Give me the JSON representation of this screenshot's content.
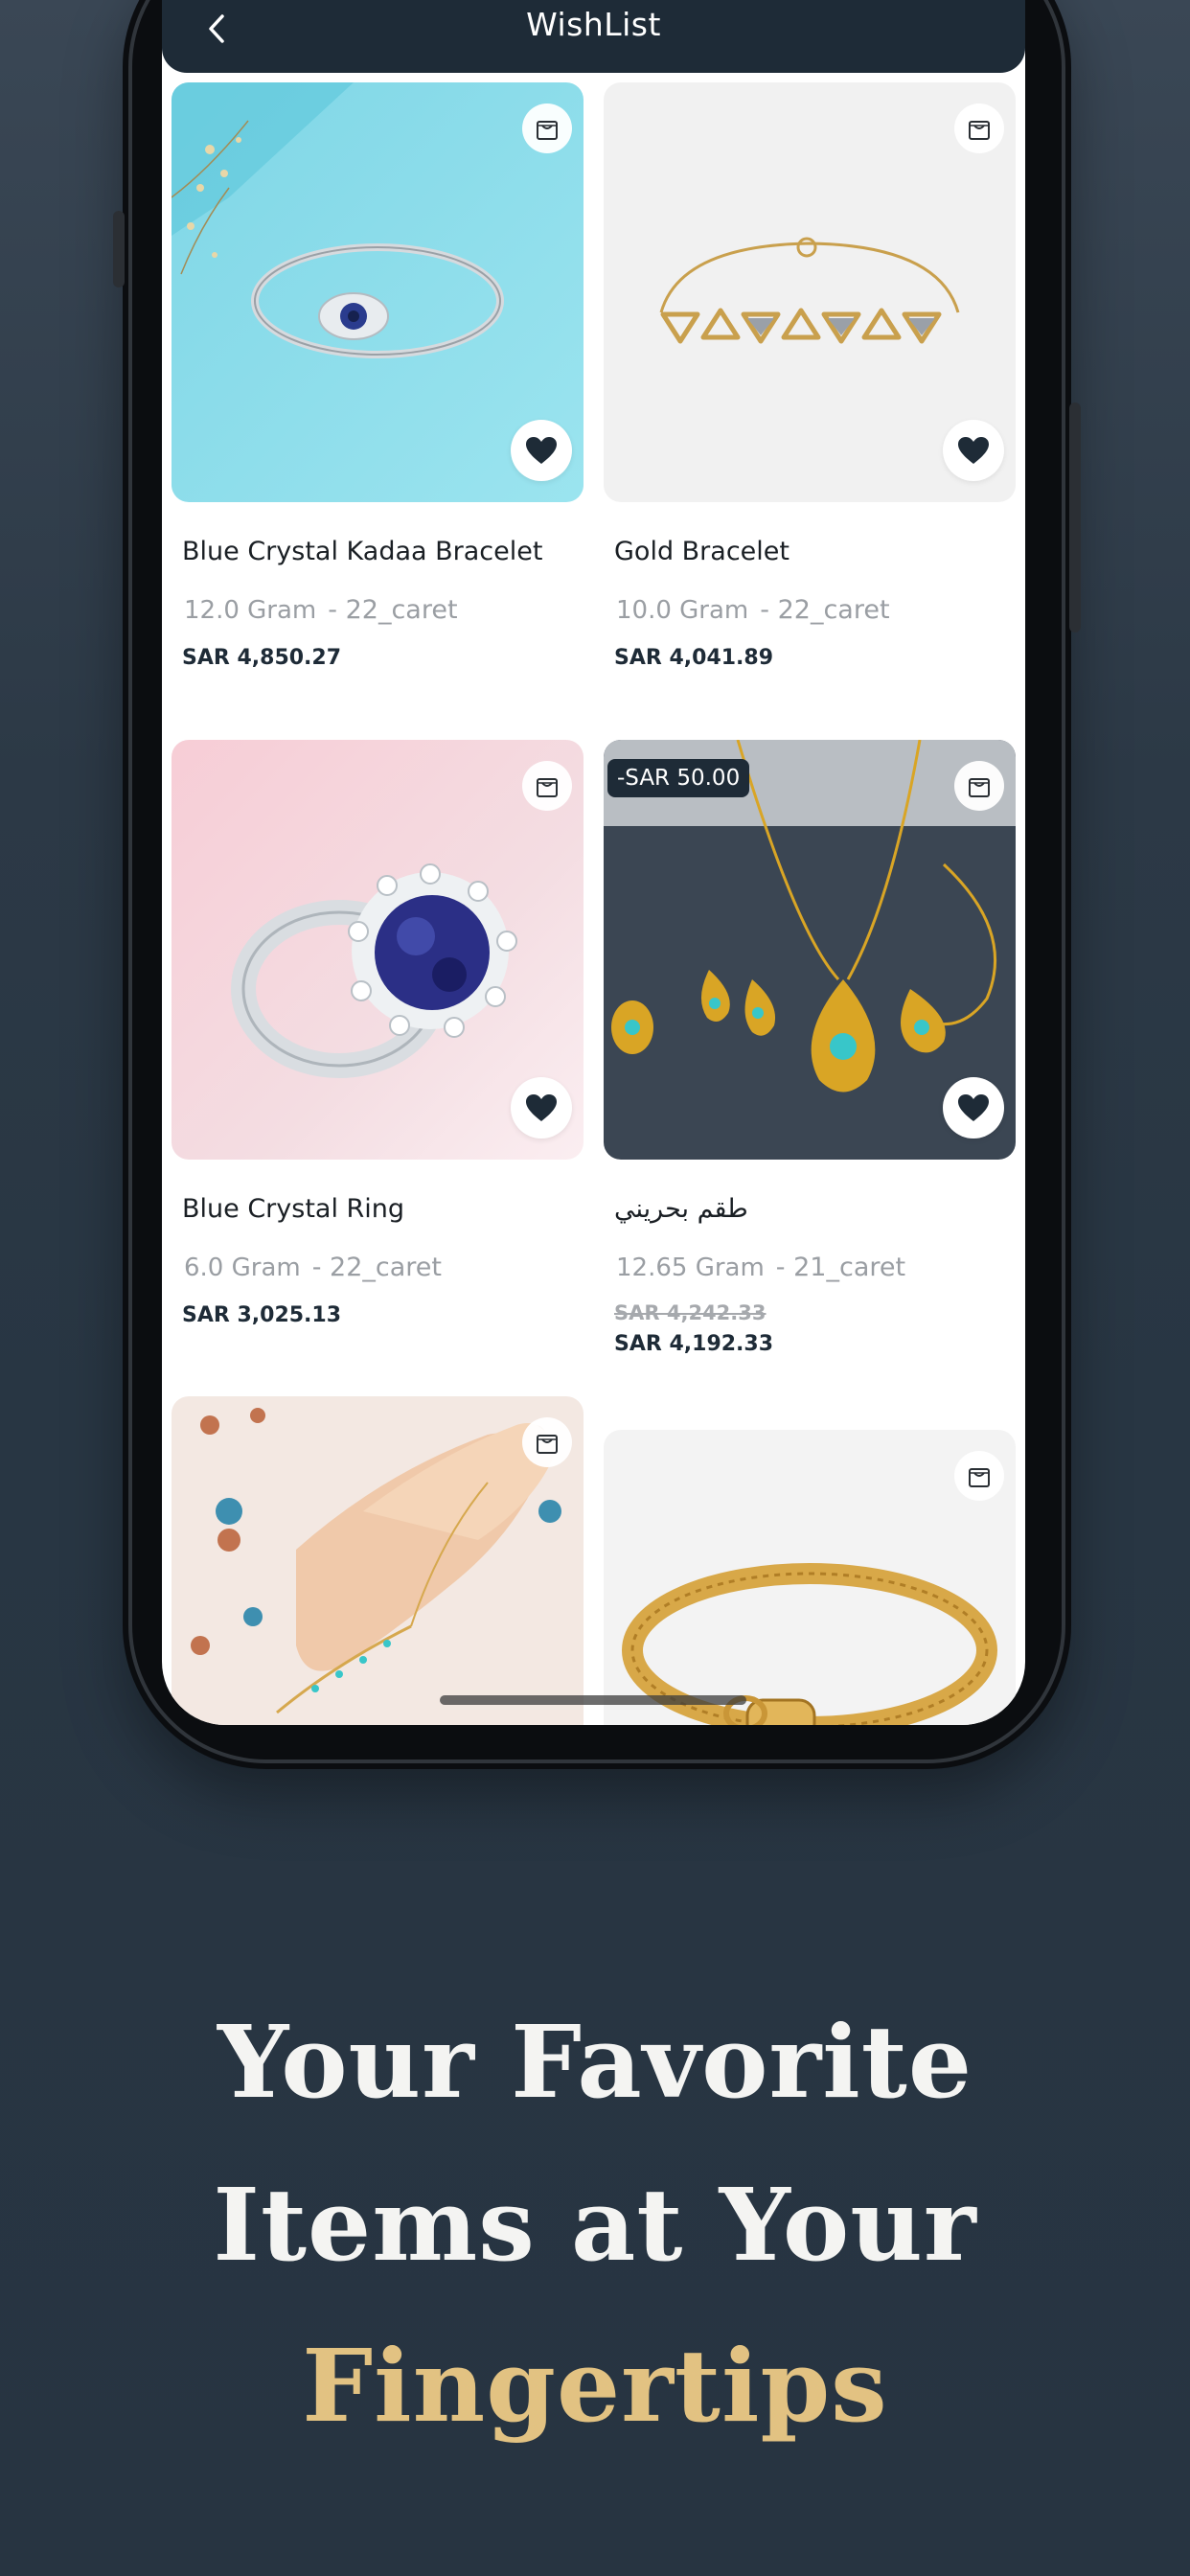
{
  "header": {
    "title": "WishList",
    "back_icon": "chevron-left-icon"
  },
  "products": [
    {
      "name": "Blue Crystal Kadaa Bracelet",
      "weight": "12.0 Gram",
      "karat": "- 22_caret",
      "price": "SAR 4,850.27",
      "favorited": true,
      "image": "silver bangle with blue evil-eye crystal on turquoise background"
    },
    {
      "name": "Gold Bracelet",
      "weight": "10.0 Gram",
      "karat": "- 22_caret",
      "price": "SAR 4,041.89",
      "favorited": true,
      "image": "gold chain bracelet with triangle links"
    },
    {
      "name": "Blue Crystal Ring",
      "weight": "6.0 Gram",
      "karat": "- 22_caret",
      "price": "SAR 3,025.13",
      "favorited": true,
      "image": "silver ring with large blue sapphire stone"
    },
    {
      "name": "طقم بحريني",
      "weight": "12.65 Gram",
      "karat": "- 21_caret",
      "old_price": "SAR 4,242.33",
      "price": "SAR 4,192.33",
      "discount": "-SAR 50.00",
      "favorited": true,
      "image": "gold jewelry set with turquoise stones on dark background"
    },
    {
      "name": "",
      "image": "hand chain bracelet worn on hand"
    },
    {
      "name": "",
      "image": "gold rope chain bracelet"
    }
  ],
  "headline": {
    "line1": "Your Favorite",
    "line2": "Items at Your",
    "line3": "Fingertips"
  },
  "colors": {
    "header_bg": "#1e2b37",
    "accent_gold": "#e2c282",
    "page_bg": "#2c3946"
  }
}
